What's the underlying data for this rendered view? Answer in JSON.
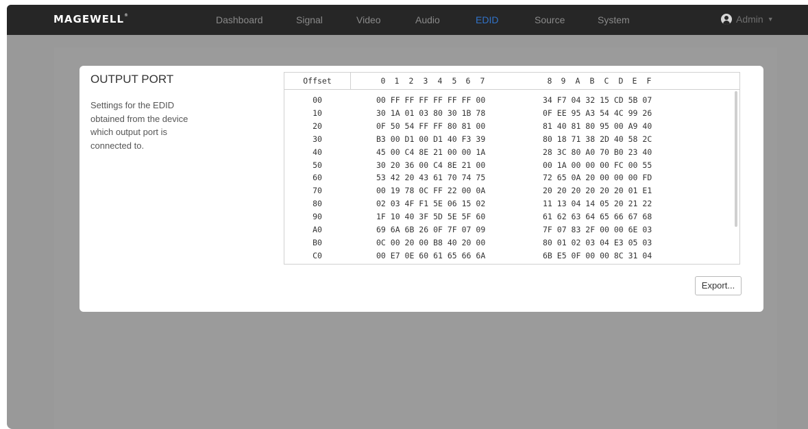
{
  "brand": {
    "logo": "MAGEWELL",
    "reg": "®"
  },
  "nav": {
    "items": [
      {
        "label": "Dashboard",
        "active": false
      },
      {
        "label": "Signal",
        "active": false
      },
      {
        "label": "Video",
        "active": false
      },
      {
        "label": "Audio",
        "active": false
      },
      {
        "label": "EDID",
        "active": true
      },
      {
        "label": "Source",
        "active": false
      },
      {
        "label": "System",
        "active": false
      }
    ],
    "user": {
      "label": "Admin",
      "icon": "user-icon",
      "caret_icon": "chevron-down-icon"
    },
    "active_color": "#3173c9"
  },
  "card": {
    "title": "OUTPUT PORT",
    "description": "Settings for the EDID obtained from the device which output port is connected to.",
    "export_label": "Export..."
  },
  "edid_table": {
    "offset_header": "Offset",
    "col_headers_1": [
      "0",
      "1",
      "2",
      "3",
      "4",
      "5",
      "6",
      "7"
    ],
    "col_headers_2": [
      "8",
      "9",
      "A",
      "B",
      "C",
      "D",
      "E",
      "F"
    ],
    "rows": [
      {
        "offset": "00",
        "b1": "00 FF FF FF FF FF FF 00",
        "b2": "34 F7 04 32 15 CD 5B 07"
      },
      {
        "offset": "10",
        "b1": "30 1A 01 03 80 30 1B 78",
        "b2": "0F EE 95 A3 54 4C 99 26"
      },
      {
        "offset": "20",
        "b1": "0F 50 54 FF FF 80 81 00",
        "b2": "81 40 81 80 95 00 A9 40"
      },
      {
        "offset": "30",
        "b1": "B3 00 D1 00 D1 40 F3 39",
        "b2": "80 18 71 38 2D 40 58 2C"
      },
      {
        "offset": "40",
        "b1": "45 00 C4 8E 21 00 00 1A",
        "b2": "28 3C 80 A0 70 B0 23 40"
      },
      {
        "offset": "50",
        "b1": "30 20 36 00 C4 8E 21 00",
        "b2": "00 1A 00 00 00 FC 00 55"
      },
      {
        "offset": "60",
        "b1": "53 42 20 43 61 70 74 75",
        "b2": "72 65 0A 20 00 00 00 FD"
      },
      {
        "offset": "70",
        "b1": "00 19 78 0C FF 22 00 0A",
        "b2": "20 20 20 20 20 20 01 E1"
      },
      {
        "offset": "80",
        "b1": "02 03 4F F1 5E 06 15 02",
        "b2": "11 13 04 14 05 20 21 22"
      },
      {
        "offset": "90",
        "b1": "1F 10 40 3F 5D 5E 5F 60",
        "b2": "61 62 63 64 65 66 67 68"
      },
      {
        "offset": "A0",
        "b1": "69 6A 6B 26 0F 7F 07 09",
        "b2": "7F 07 83 2F 00 00 6E 03"
      },
      {
        "offset": "B0",
        "b1": "0C 00 20 00 B8 40 20 00",
        "b2": "80 01 02 03 04 E3 05 03"
      },
      {
        "offset": "C0",
        "b1": "00 E7 0E 60 61 65 66 6A",
        "b2": "6B E5 0F 00 00 8C 31 04"
      }
    ]
  }
}
